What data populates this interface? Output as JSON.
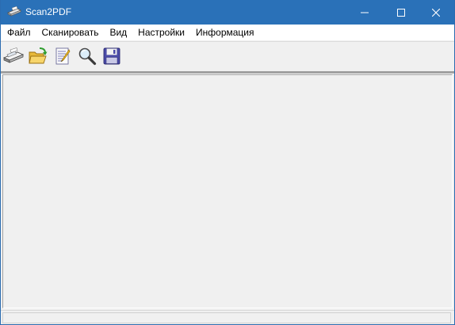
{
  "window": {
    "title": "Scan2PDF",
    "controls": {
      "minimize_icon": "minimize-icon",
      "maximize_icon": "maximize-icon",
      "close_icon": "close-icon"
    }
  },
  "menu": {
    "items": [
      {
        "label": "Файл"
      },
      {
        "label": "Сканировать"
      },
      {
        "label": "Вид"
      },
      {
        "label": "Настройки"
      },
      {
        "label": "Информация"
      }
    ]
  },
  "toolbar": {
    "buttons": [
      {
        "icon": "scanner-icon"
      },
      {
        "icon": "open-folder-icon"
      },
      {
        "icon": "edit-document-icon"
      },
      {
        "icon": "magnifier-icon"
      },
      {
        "icon": "floppy-disk-icon"
      }
    ]
  },
  "statusbar": {
    "text": ""
  },
  "colors": {
    "titlebar": "#2a71b8",
    "background": "#f0f0f0",
    "menubar": "#ffffff"
  }
}
